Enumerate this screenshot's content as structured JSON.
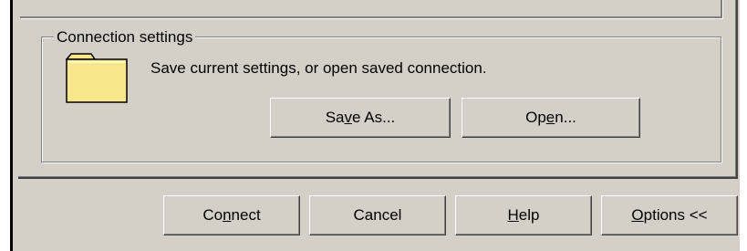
{
  "connection_settings": {
    "group_title": "Connection settings",
    "description": "Save current settings, or open saved connection.",
    "folder_icon": "folder-icon",
    "save_as": {
      "pre": "Sa",
      "key": "v",
      "post": "e As..."
    },
    "open": {
      "pre": "Op",
      "key": "e",
      "post": "n..."
    }
  },
  "footer": {
    "connect": {
      "pre": "Co",
      "key": "n",
      "post": "nect"
    },
    "cancel": {
      "label": "Cancel"
    },
    "help": {
      "pre": "",
      "key": "H",
      "post": "elp"
    },
    "options": {
      "pre": "",
      "key": "O",
      "post": "ptions <<"
    }
  },
  "colors": {
    "face": "#d4d0c8",
    "shadow": "#808080",
    "dark_shadow": "#404040",
    "highlight": "#ffffff",
    "folder": "#f8e58c"
  }
}
